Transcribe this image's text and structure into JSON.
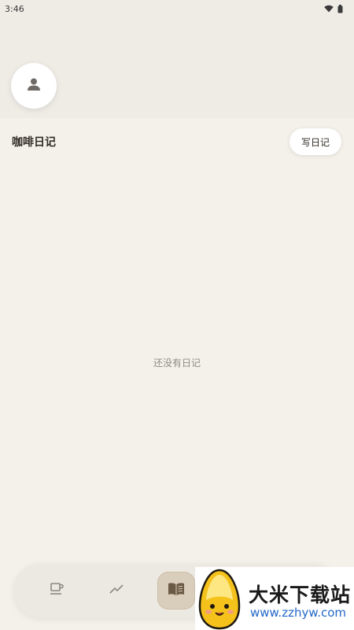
{
  "status_bar": {
    "time": "3:46"
  },
  "header": {
    "title": "咖啡日记",
    "write_button": "写日记"
  },
  "main": {
    "empty_message": "还没有日记"
  },
  "bottom_nav": {
    "items": [
      {
        "icon": "coffee-cup-icon",
        "active": false
      },
      {
        "icon": "trend-line-icon",
        "active": false
      },
      {
        "icon": "open-book-icon",
        "active": true
      }
    ]
  },
  "watermark": {
    "title": "大米下载站",
    "url": "www.zzhyw.com"
  },
  "colors": {
    "background": "#f4f0ea",
    "header_band": "#efece6",
    "active_tab": "#d9cdbb",
    "watermark_link": "#2268c8"
  }
}
